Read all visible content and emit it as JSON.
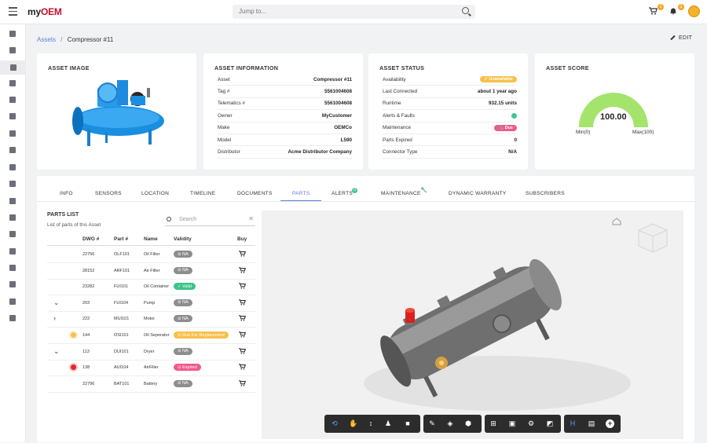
{
  "header": {
    "logo_my": "my",
    "logo_oem": "OEM",
    "search_placeholder": "Jump to...",
    "cart_count": "1",
    "bell_count": "1"
  },
  "breadcrumb": {
    "parent": "Assets",
    "sep": "/",
    "current": "Compressor #11"
  },
  "edit_label": "EDIT",
  "asset_image": {
    "title": "ASSET IMAGE"
  },
  "asset_info": {
    "title": "ASSET INFORMATION",
    "rows": [
      {
        "k": "Asset",
        "v": "Compressor #11"
      },
      {
        "k": "Tag #",
        "v": "5561004608"
      },
      {
        "k": "Telematics #",
        "v": "5561004608"
      },
      {
        "k": "Owner",
        "v": "MyCustomer"
      },
      {
        "k": "Make",
        "v": "OEMCo"
      },
      {
        "k": "Model",
        "v": "L590"
      },
      {
        "k": "Distributor",
        "v": "Acme Distributor Company"
      }
    ]
  },
  "asset_status": {
    "title": "ASSET STATUS",
    "rows": [
      {
        "k": "Availability",
        "v": "✓ Unavailable",
        "pill": "#f7c04b"
      },
      {
        "k": "Last Connected",
        "v": "about 1 year ago"
      },
      {
        "k": "Runtime",
        "v": "932.15 units"
      },
      {
        "k": "Alerts & Faults",
        "v": "",
        "dot": "#46c39a"
      },
      {
        "k": "Maintenance",
        "v": "🔧 Due",
        "pill": "#f05a8a"
      },
      {
        "k": "Parts Expired",
        "v": "0"
      },
      {
        "k": "Connector Type",
        "v": "N/A"
      }
    ]
  },
  "asset_score": {
    "title": "ASSET SCORE",
    "value": "100.00",
    "score": 100,
    "min_label": "Min(0)",
    "max_label": "Max(100)",
    "color": "#a4e46d"
  },
  "tabs": [
    "INFO",
    "SENSORS",
    "LOCATION",
    "TIMELINE",
    "DOCUMENTS",
    "PARTS",
    "ALERTS",
    "MAINTENANCE",
    "DYNAMIC WARRANTY",
    "SUBSCRIBERS"
  ],
  "tabs_active": "PARTS",
  "alerts_badge": "0",
  "parts": {
    "title": "PARTS LIST",
    "subtitle": "List of parts of this Asset",
    "search_placeholder": "Search",
    "headers": [
      "DWG #",
      "Part #",
      "Name",
      "Validity",
      "Buy"
    ],
    "rows": [
      {
        "dwg": "22756",
        "part": "OLF101",
        "name": "Oil Filter",
        "validity": "⊘ NA",
        "color": "#8d8d8d",
        "exp": "",
        "mark": ""
      },
      {
        "dwg": "28152",
        "part": "ARF101",
        "name": "Air Filter",
        "validity": "⊘ NA",
        "color": "#8d8d8d",
        "exp": "",
        "mark": ""
      },
      {
        "dwg": "23282",
        "part": "FUI101",
        "name": "Oil Container",
        "validity": "✓ Valid",
        "color": "#3dc38a",
        "exp": "",
        "mark": ""
      },
      {
        "dwg": "203",
        "part": "FUI104",
        "name": "Pump",
        "validity": "⊘ NA",
        "color": "#8d8d8d",
        "exp": "⌄",
        "mark": ""
      },
      {
        "dwg": "222",
        "part": "MUI101",
        "name": "Motor",
        "validity": "⊘ NA",
        "color": "#8d8d8d",
        "exp": "›",
        "mark": ""
      },
      {
        "dwg": "144",
        "part": "OSI101",
        "name": "Oil Seperator",
        "validity": "⊙ Due For Replacement",
        "color": "#f7c04b",
        "exp": "",
        "mark": "#f7c04b"
      },
      {
        "dwg": "113",
        "part": "DUI101",
        "name": "Dryer",
        "validity": "⊘ NA",
        "color": "#8d8d8d",
        "exp": "⌄",
        "mark": ""
      },
      {
        "dwg": "138",
        "part": "AUI104",
        "name": "AirFiller",
        "validity": "⊙ Expired",
        "color": "#f05a8a",
        "exp": "",
        "mark": "#e42626"
      },
      {
        "dwg": "22796",
        "part": "BAT101",
        "name": "Battery",
        "validity": "⊘ NA",
        "color": "#8d8d8d",
        "exp": "",
        "mark": ""
      }
    ]
  },
  "toolbar": {
    "measure_label": "H"
  }
}
